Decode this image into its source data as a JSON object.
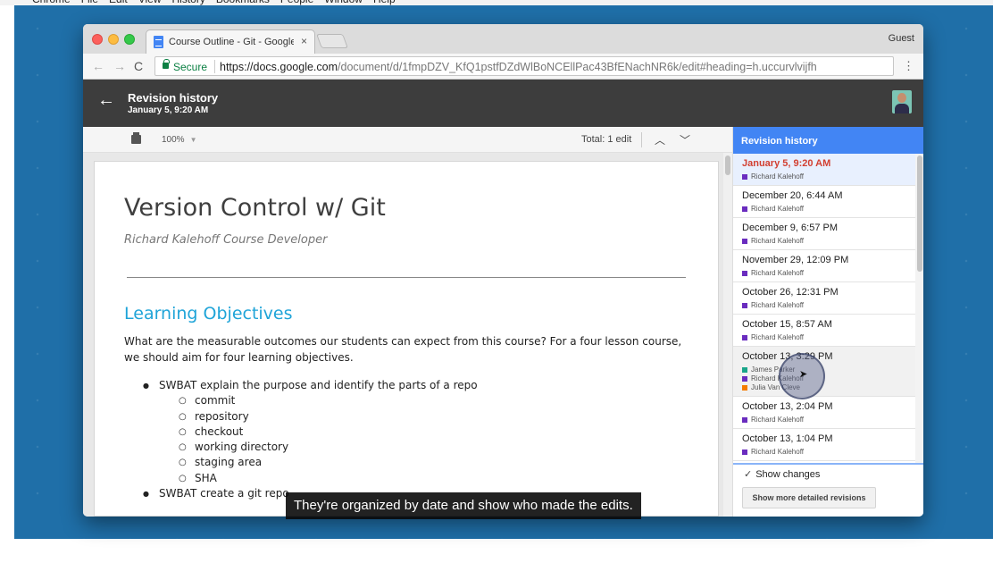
{
  "mac_menu": [
    "Chrome",
    "File",
    "Edit",
    "View",
    "History",
    "Bookmarks",
    "People",
    "Window",
    "Help"
  ],
  "browser": {
    "tab_title": "Course Outline - Git - Google",
    "tab_close": "×",
    "profile": "Guest",
    "secure_label": "Secure",
    "url_host": "https://docs.google.com",
    "url_path": "/document/d/1fmpDZV_KfQ1pstfDZdWlBoNCEllPac43BfENachNR6k/edit#heading=h.uccurvlvijfh",
    "menu_icon": "⋮"
  },
  "revision_header": {
    "title": "Revision history",
    "subtitle": "January 5, 9:20 AM",
    "back_icon": "←"
  },
  "doc_toolbar": {
    "zoom": "100%",
    "total_edits": "Total: 1 edit",
    "prev_icon": "︿",
    "next_icon": "﹀"
  },
  "document": {
    "title": "Version Control w/ Git",
    "author_line": "Richard Kalehoff Course Developer",
    "section_heading": "Learning Objectives",
    "intro": "What are the measurable outcomes our students can expect from this course? For a four lesson course, we should aim for four learning objectives.",
    "objective_1": "SWBAT explain the purpose and identify the parts of a repo",
    "objective_1_parts": [
      "commit",
      "repository",
      "checkout",
      "working directory",
      "staging area",
      "SHA"
    ],
    "objective_2": "SWBAT create a git repo"
  },
  "revision_panel": {
    "title": "Revision history",
    "show_changes": "Show changes",
    "show_changes_checked": true,
    "more_button": "Show more detailed revisions",
    "author_colors": {
      "Richard Kalehoff": "#6a2cbf",
      "James Parker": "#1aa58a",
      "Julia Van Cleve": "#f57c00"
    },
    "revisions": [
      {
        "date": "January 5, 9:20 AM",
        "authors": [
          "Richard Kalehoff"
        ],
        "selected": true
      },
      {
        "date": "December 20, 6:44 AM",
        "authors": [
          "Richard Kalehoff"
        ]
      },
      {
        "date": "December 9, 6:57 PM",
        "authors": [
          "Richard Kalehoff"
        ]
      },
      {
        "date": "November 29, 12:09 PM",
        "authors": [
          "Richard Kalehoff"
        ]
      },
      {
        "date": "October 26, 12:31 PM",
        "authors": [
          "Richard Kalehoff"
        ]
      },
      {
        "date": "October 15, 8:57 AM",
        "authors": [
          "Richard Kalehoff"
        ]
      },
      {
        "date": "October 13, 3:29 PM",
        "authors": [
          "James Parker",
          "Richard Kalehoff",
          "Julia Van Cleve"
        ],
        "hovered": true
      },
      {
        "date": "October 13, 2:04 PM",
        "authors": [
          "Richard Kalehoff"
        ]
      },
      {
        "date": "October 13, 1:04 PM",
        "authors": [
          "Richard Kalehoff"
        ]
      }
    ]
  },
  "caption": "They're organized by date and show who made the edits.",
  "colors": {
    "accent": "#4285f4",
    "selected_date": "#d23f31",
    "header_bg": "#3d3d3d",
    "heading_blue": "#1fa4d8",
    "desktop": "#1f6fa8"
  }
}
